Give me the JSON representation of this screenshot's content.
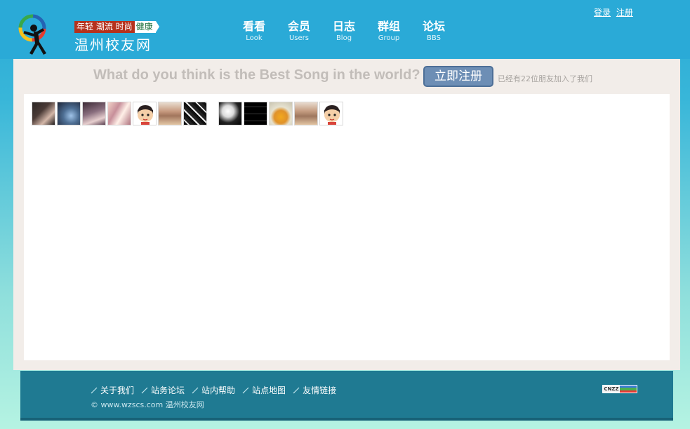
{
  "header": {
    "slogan_main": "年轻 潮流 时尚",
    "slogan_tail": "健康",
    "site_name": "温州校友网",
    "nav": [
      {
        "cn": "看看",
        "en": "Look"
      },
      {
        "cn": "会员",
        "en": "Users"
      },
      {
        "cn": "日志",
        "en": "Blog"
      },
      {
        "cn": "群组",
        "en": "Group"
      },
      {
        "cn": "论坛",
        "en": "BBS"
      }
    ],
    "login": "登录",
    "register": "注册"
  },
  "banner": {
    "question": "What do you think is the Best Song in the world?",
    "register_button": "立即注册",
    "joined_text": "已经有22位朋友加入了我们"
  },
  "footer": {
    "links": [
      "关于我们",
      "站务论坛",
      "站内帮助",
      "站点地图",
      "友情链接"
    ],
    "copyright": "© www.wzscs.com 温州校友网",
    "badge": "CNZZ"
  },
  "colors": {
    "header_bg": "#2aaad7",
    "footer_bg": "#1f7a92",
    "button_bg": "#6d8eb5",
    "slogan_red": "#b5321d"
  }
}
